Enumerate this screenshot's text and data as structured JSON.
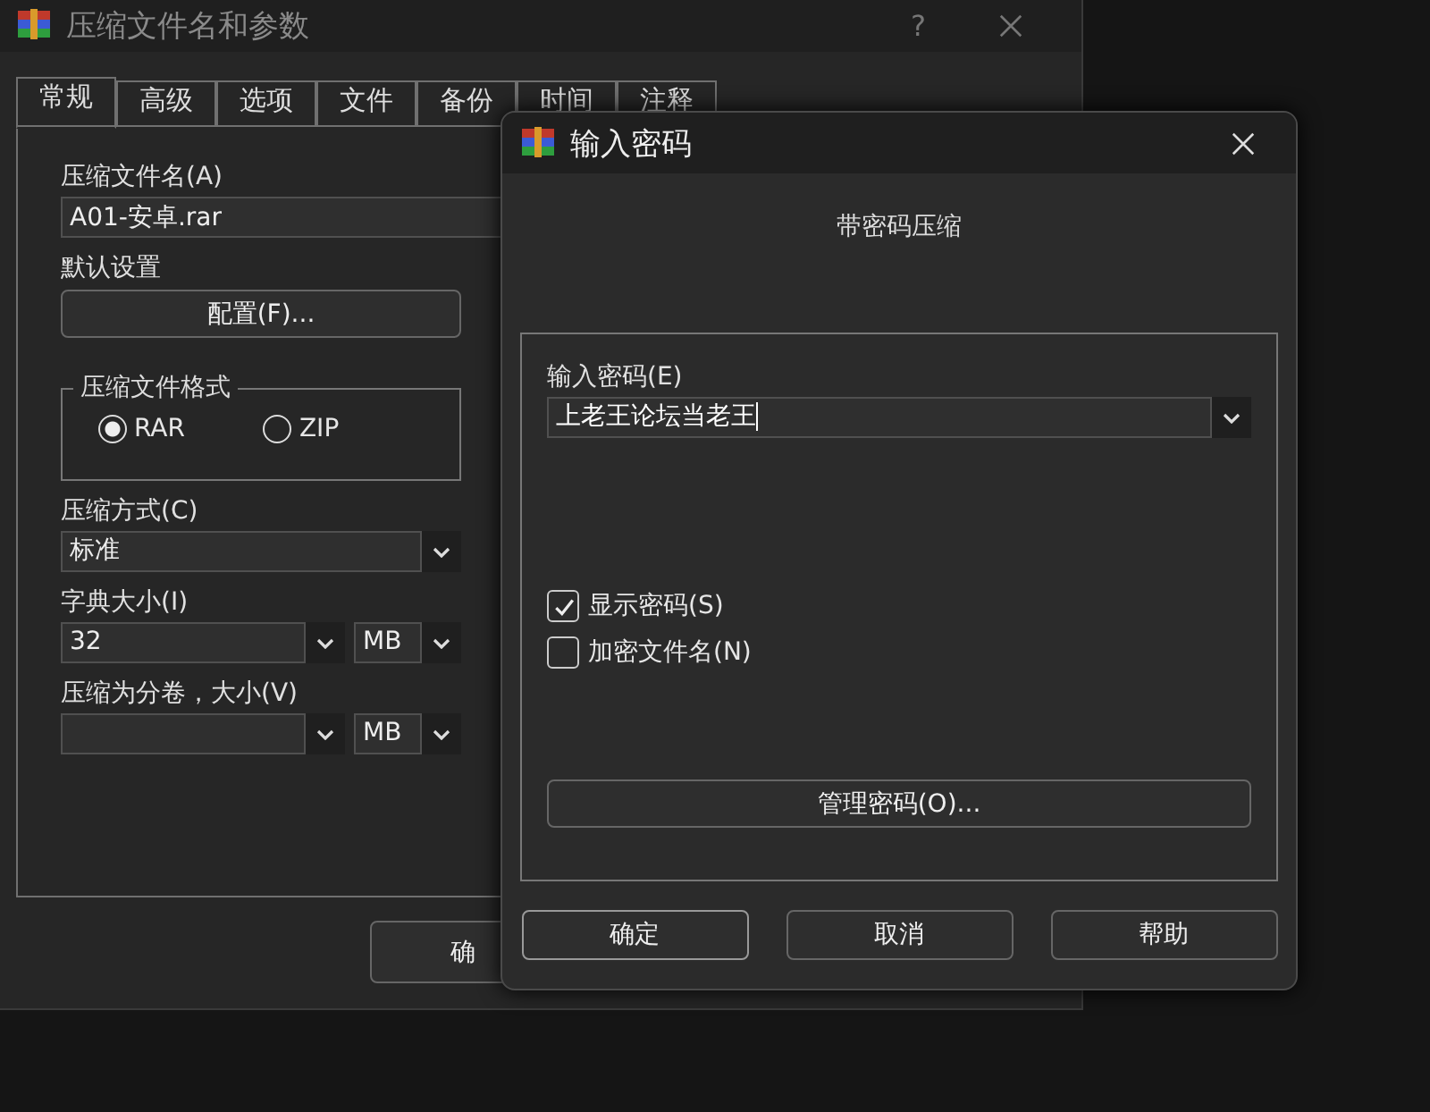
{
  "back_window": {
    "title": "压缩文件名和参数",
    "help_button": "?",
    "tabs": [
      {
        "label": "常规",
        "selected": true
      },
      {
        "label": "高级",
        "selected": false
      },
      {
        "label": "选项",
        "selected": false
      },
      {
        "label": "文件",
        "selected": false
      },
      {
        "label": "备份",
        "selected": false
      },
      {
        "label": "时间",
        "selected": false
      },
      {
        "label": "注释",
        "selected": false
      }
    ],
    "archive_name_label": "压缩文件名(A)",
    "archive_name": "A01-安卓.rar",
    "profile_label": "默认设置",
    "profile_button": "配置(F)...",
    "format_group": "压缩文件格式",
    "formats": [
      {
        "label": "RAR",
        "selected": true
      },
      {
        "label": "ZIP",
        "selected": false
      }
    ],
    "method_label": "压缩方式(C)",
    "method": "标准",
    "dictionary_label": "字典大小(I)",
    "dictionary": "32",
    "dictionary_unit": "MB",
    "volume_label": "压缩为分卷，大小(V)",
    "volume_unit": "MB",
    "ok_button": "确"
  },
  "dialog": {
    "title": "输入密码",
    "heading": "带密码压缩",
    "password_label": "输入密码(E)",
    "password": "上老王论坛当老王",
    "options": [
      {
        "label": "显示密码(S)",
        "checked": true
      },
      {
        "label": "加密文件名(N)",
        "checked": false
      }
    ],
    "manage_button": "管理密码(O)...",
    "buttons": [
      "确定",
      "取消",
      "帮助"
    ]
  }
}
